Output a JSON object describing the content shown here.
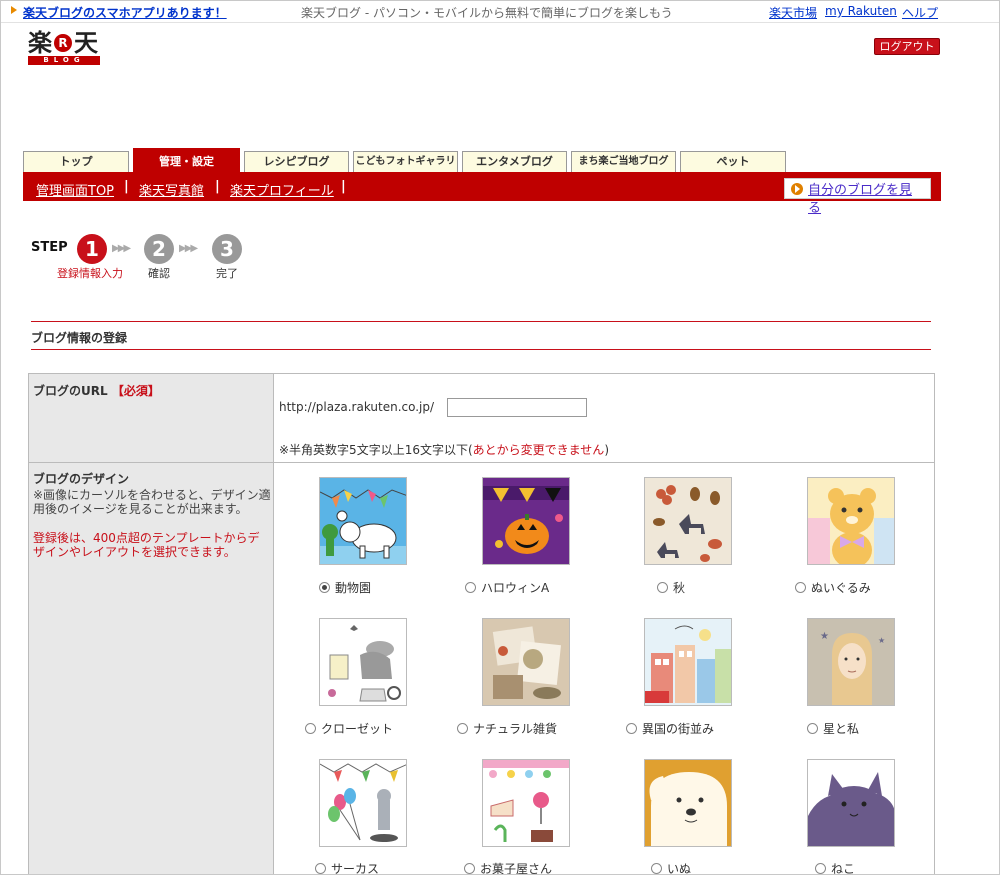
{
  "topbar": {
    "promo": "楽天ブログのスマホアプリあります！",
    "tagline": "楽天ブログ - パソコン・モバイルから無料で簡単にブログを楽しもう",
    "links": [
      "楽天市場",
      "my Rakuten",
      "ヘルプ"
    ]
  },
  "logo": {
    "kanji1": "楽",
    "r": "R",
    "kanji2": "天",
    "blog": "BLOG"
  },
  "logout_label": "ログアウト",
  "tabs": [
    {
      "label": "トップ",
      "active": false
    },
    {
      "label": "管理・設定",
      "active": true
    },
    {
      "label": "レシピブログ",
      "active": false
    },
    {
      "label": "こどもフォトギャラリー",
      "active": false
    },
    {
      "label": "エンタメブログ",
      "active": false
    },
    {
      "label": "まち楽ご当地ブログ",
      "active": false
    },
    {
      "label": "ペット",
      "active": false
    }
  ],
  "subnav": {
    "links": [
      "管理画面TOP",
      "楽天写真館",
      "楽天プロフィール"
    ],
    "sep": "|",
    "my_blog": "自分のブログを見る"
  },
  "steps": {
    "label": "STEP",
    "arrows": "▶▶▶",
    "items": [
      {
        "num": "1",
        "label": "登録情報入力",
        "active": true
      },
      {
        "num": "2",
        "label": "確認",
        "active": false
      },
      {
        "num": "3",
        "label": "完了",
        "active": false
      }
    ]
  },
  "section_title": "ブログ情報の登録",
  "form": {
    "url_label": "ブログのURL",
    "required": "【必須】",
    "url_prefix": "http://plaza.rakuten.co.jp/",
    "url_value": "",
    "url_note_1": "※半角英数字5文字以上16文字以下(",
    "url_note_red": "あとから変更できません",
    "url_note_2": ")",
    "design_label": "ブログのデザイン",
    "design_note": "※画像にカーソルを合わせると、デザイン適用後のイメージを見ることが出来ます。",
    "design_note_red": "登録後は、400点超のテンプレートからデザインやレイアウトを選択できます。",
    "designs": [
      {
        "label": "動物園",
        "checked": true
      },
      {
        "label": "ハロウィンA",
        "checked": false
      },
      {
        "label": "秋",
        "checked": false
      },
      {
        "label": "ぬいぐるみ",
        "checked": false
      },
      {
        "label": "クローゼット",
        "checked": false
      },
      {
        "label": "ナチュラル雑貨",
        "checked": false
      },
      {
        "label": "異国の街並み",
        "checked": false
      },
      {
        "label": "星と私",
        "checked": false
      },
      {
        "label": "サーカス",
        "checked": false
      },
      {
        "label": "お菓子屋さん",
        "checked": false
      },
      {
        "label": "いぬ",
        "checked": false
      },
      {
        "label": "ねこ",
        "checked": false
      }
    ]
  },
  "colors": {
    "brand_red": "#bf0000",
    "tab_bg": "#fdfbe0",
    "link": "#0033cc"
  }
}
